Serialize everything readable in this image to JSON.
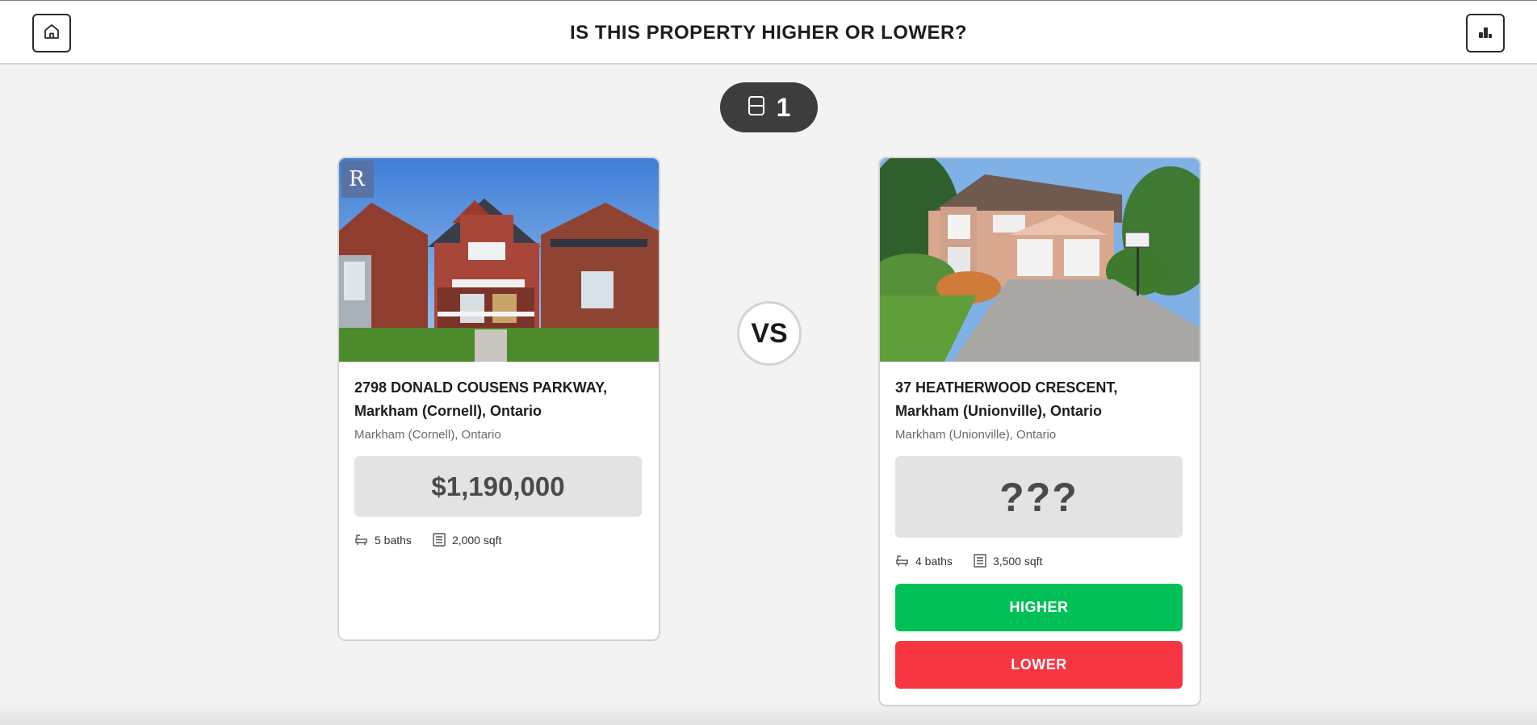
{
  "header": {
    "title": "IS THIS PROPERTY HIGHER OR LOWER?",
    "home_icon": "home-icon",
    "stats_icon": "bar-chart-icon"
  },
  "score": {
    "value": "1",
    "icon": "house-card-icon"
  },
  "vs_label": "VS",
  "left_card": {
    "address": "2798 DONALD COUSENS PARKWAY, Markham (Cornell), Ontario",
    "location": "Markham (Cornell), Ontario",
    "price": "$1,190,000",
    "baths": "5 baths",
    "sqft": "2,000 sqft"
  },
  "right_card": {
    "address": "37 HEATHERWOOD CRESCENT, Markham (Unionville), Ontario",
    "location": "Markham (Unionville), Ontario",
    "price": "???",
    "baths": "4 baths",
    "sqft": "3,500 sqft",
    "higher_label": "HIGHER",
    "lower_label": "LOWER"
  },
  "colors": {
    "higher": "#00c058",
    "lower": "#f73642",
    "score_pill": "#3d3d3d",
    "price_box": "#e3e3e3"
  }
}
